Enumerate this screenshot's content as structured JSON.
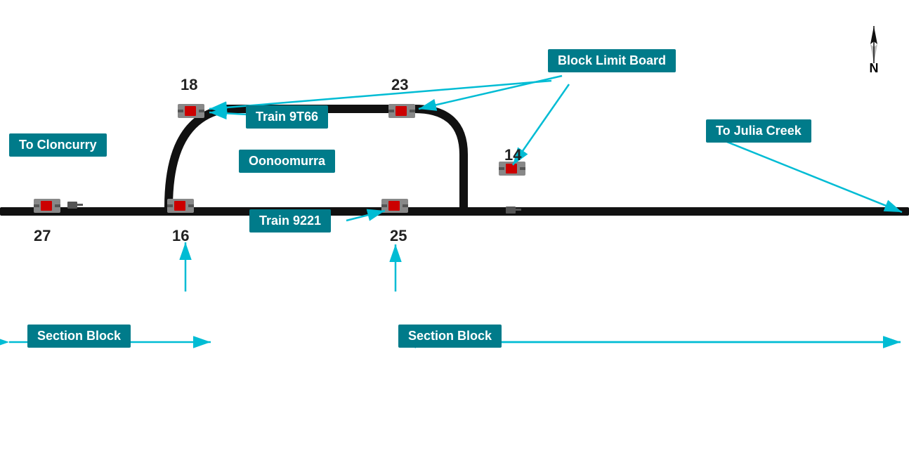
{
  "labels": {
    "block_limit_board": "Block Limit Board",
    "train_9t66": "Train 9T66",
    "to_cloncurry": "To Cloncurry",
    "oonoomurra": "Oonoomurra",
    "train_9221": "Train 9221",
    "to_julia_creek": "To Julia Creek",
    "section_block_left": "Section Block",
    "section_block_right": "Section Block",
    "compass_letter": "N"
  },
  "numbers": {
    "n18": "18",
    "n23": "23",
    "n14": "14",
    "n27": "27",
    "n16": "16",
    "n25": "25"
  },
  "colors": {
    "track": "#111111",
    "arrow": "#00bcd4",
    "label_bg": "#007b8a",
    "label_text": "#ffffff",
    "signal_red": "#cc0000",
    "signal_body": "#666666"
  }
}
